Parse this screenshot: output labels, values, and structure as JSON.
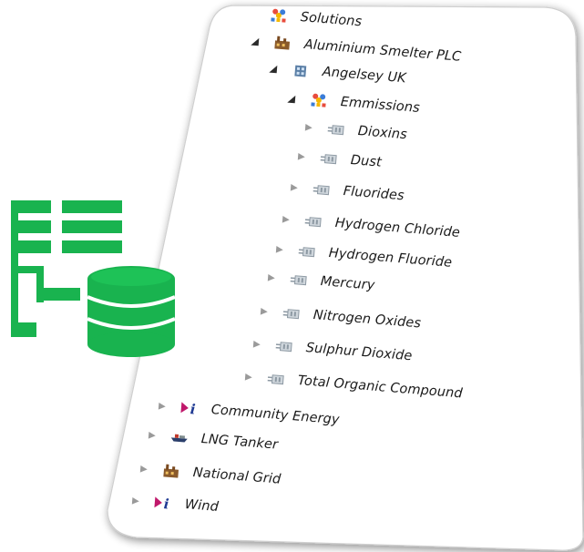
{
  "colors": {
    "accent_green": "#19b34f",
    "panel_border": "#c9c9c9",
    "text": "#1a1a1a",
    "arrow": "#9a9a9a"
  },
  "big_icon": "database-tree-icon",
  "tree": {
    "items": [
      {
        "label": "Solutions",
        "icon": "solutions-icon",
        "toggle": ""
      },
      {
        "label": "Aluminium Smelter PLC",
        "icon": "factory-icon",
        "toggle": "◢"
      },
      {
        "label": "Angelsey UK",
        "icon": "site-icon",
        "toggle": "◢"
      },
      {
        "label": "Emmissions",
        "icon": "solutions-icon",
        "toggle": "◢"
      },
      {
        "label": "Dioxins",
        "icon": "sensor-icon",
        "toggle": "▶"
      },
      {
        "label": "Dust",
        "icon": "sensor-icon",
        "toggle": "▶"
      },
      {
        "label": "Fluorides",
        "icon": "sensor-icon",
        "toggle": "▶"
      },
      {
        "label": "Hydrogen Chloride",
        "icon": "sensor-icon",
        "toggle": "▶"
      },
      {
        "label": "Hydrogen Fluoride",
        "icon": "sensor-icon",
        "toggle": "▶"
      },
      {
        "label": "Mercury",
        "icon": "sensor-icon",
        "toggle": "▶"
      },
      {
        "label": "Nitrogen Oxides",
        "icon": "sensor-icon",
        "toggle": "▶"
      },
      {
        "label": "Sulphur Dioxide",
        "icon": "sensor-icon",
        "toggle": "▶"
      },
      {
        "label": "Total Organic Compound",
        "icon": "sensor-icon",
        "toggle": "▶"
      },
      {
        "label": "Community Energy",
        "icon": "play-info-icon",
        "toggle": "▶"
      },
      {
        "label": "LNG Tanker",
        "icon": "tanker-icon",
        "toggle": "▶"
      },
      {
        "label": "National Grid",
        "icon": "factory-icon",
        "toggle": "▶"
      },
      {
        "label": "Wind",
        "icon": "play-info-icon",
        "toggle": "▶"
      }
    ]
  }
}
